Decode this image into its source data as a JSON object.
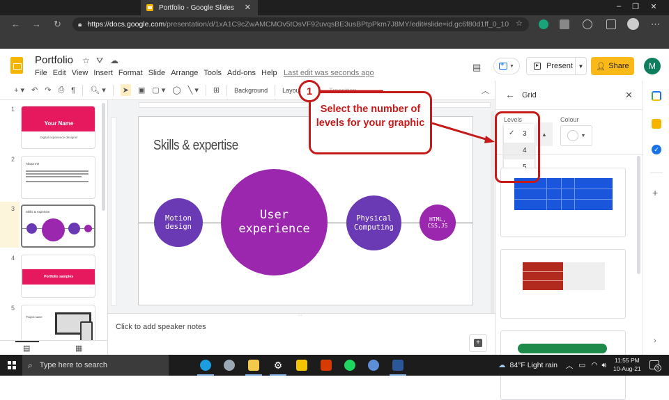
{
  "browser": {
    "tab_title": "Portfolio - Google Slides",
    "url_scheme": "https://",
    "url_host": "docs.google.com",
    "url_path": "/presentation/d/1xA1C9cZwAMCMOv5tOsVF92uvqsBE3usBPtpPkm7J8MY/edit#slide=id.gc6f80d1ff_0_10",
    "controls": {
      "minimize": "–",
      "restore": "❐",
      "close": "✕"
    }
  },
  "app": {
    "doc_title": "Portfolio",
    "menu": [
      "File",
      "Edit",
      "View",
      "Insert",
      "Format",
      "Slide",
      "Arrange",
      "Tools",
      "Add-ons",
      "Help"
    ],
    "last_edit": "Last edit was seconds ago",
    "present_label": "Present",
    "share_label": "Share",
    "avatar_initial": "M",
    "brand_color": "#f5b400"
  },
  "toolbar": {
    "background_label": "Background",
    "layout_label": "Layout",
    "transition_label": "Transition"
  },
  "filmstrip": {
    "slides": [
      {
        "number": "1",
        "title": "Your Name",
        "subtitle": "Digital experience designer"
      },
      {
        "number": "2",
        "title": "About me"
      },
      {
        "number": "3",
        "title": "Skills & expertise",
        "active": true
      },
      {
        "number": "4",
        "title": "Portfolio samples"
      },
      {
        "number": "5",
        "title": "Project name"
      }
    ]
  },
  "slide": {
    "title": "Skills & expertise",
    "bubbles": [
      {
        "label": "Motion design",
        "color": "#6a3ab5"
      },
      {
        "label": "User experience",
        "color": "#9b27af"
      },
      {
        "label": "Physical Computing",
        "color": "#6a3ab5"
      },
      {
        "label": "HTML, CSS,JS",
        "color": "#9b27af"
      }
    ]
  },
  "notes": {
    "placeholder": "Click to add speaker notes"
  },
  "panel": {
    "title": "Grid",
    "levels_label": "Levels",
    "colour_label": "Colour",
    "levels_options": [
      "3",
      "4",
      "5"
    ],
    "levels_selected": "3",
    "templates": [
      {
        "name": "blue-table-template",
        "color": "#1a56db"
      },
      {
        "name": "red-arrow-template",
        "color": "#b22a1e"
      },
      {
        "name": "green-pill-template",
        "color": "#1e8a4a"
      }
    ]
  },
  "annotation": {
    "step": "1",
    "text": "Select the number of levels for your graphic",
    "color": "#c51a1a"
  },
  "taskbar": {
    "search_placeholder": "Type here to search",
    "weather": "84°F  Light rain",
    "time": "11:55 PM",
    "date": "10-Aug-21",
    "notification_count": "5"
  }
}
